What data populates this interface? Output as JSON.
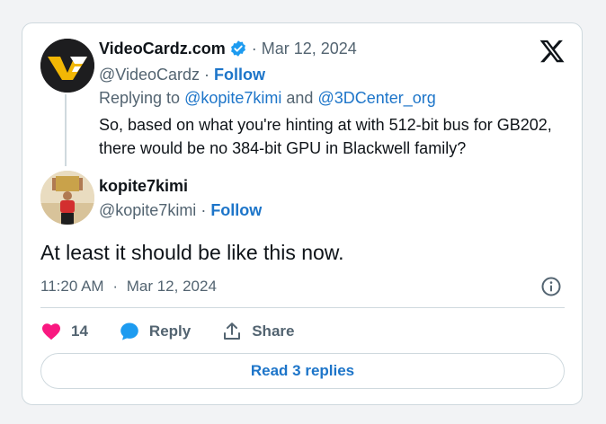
{
  "parent_tweet": {
    "display_name": "VideoCardz.com",
    "verified_icon": "verified-badge-icon",
    "date": "Mar 12, 2024",
    "handle": "@VideoCardz",
    "follow_label": "Follow",
    "replying_prefix": "Replying to",
    "reply_target_1": "@kopite7kimi",
    "reply_and": "and",
    "reply_target_2": "@3DCenter_org",
    "text": "So, based on what you're hinting at with 512-bit bus for GB202, there would be no 384-bit GPU in Blackwell family?",
    "avatar_text": "VC"
  },
  "main_tweet": {
    "display_name": "kopite7kimi",
    "handle": "@kopite7kimi",
    "follow_label": "Follow",
    "text": "At least it should be like this now.",
    "time": "11:20 AM",
    "date": "Mar 12, 2024",
    "avatar_sign_text": "DOWN OUT"
  },
  "actions": {
    "like_count": "14",
    "reply_label": "Reply",
    "share_label": "Share"
  },
  "read_replies_label": "Read 3 replies",
  "colors": {
    "link": "#1d75c9",
    "like": "#f91880",
    "reply_icon": "#1d9bf0",
    "verified": "#1d9bf0",
    "muted": "#536471"
  },
  "sep": "·"
}
